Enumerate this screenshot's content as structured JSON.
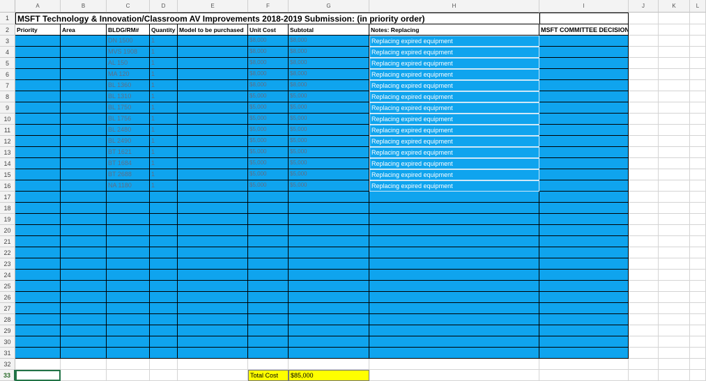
{
  "columns": [
    "A",
    "B",
    "C",
    "D",
    "E",
    "F",
    "G",
    "H",
    "I",
    "J",
    "K",
    "L"
  ],
  "row_numbers": [
    "1",
    "2",
    "3",
    "4",
    "5",
    "6",
    "7",
    "8",
    "9",
    "10",
    "11",
    "12",
    "13",
    "14",
    "15",
    "16",
    "17",
    "18",
    "19",
    "20",
    "21",
    "22",
    "23",
    "24",
    "25",
    "26",
    "27",
    "28",
    "29",
    "30",
    "31",
    "32",
    "33"
  ],
  "active_row": "33",
  "title": "MSFT Technology & Innovation/Classroom AV Improvements 2018-2019 Submission: (in priority order)",
  "headers": {
    "priority": "Priority",
    "area": "Area",
    "bldg": "BLDG/RM#",
    "quantity": "Quantity",
    "model": "Model to be purchased",
    "unit_cost": "Unit Cost",
    "subtotal": "Subtotal",
    "notes": "Notes: Replacing",
    "decision": "MSFT COMMITTEE DECISION:"
  },
  "rows": [
    {
      "bldg": "DN 1500",
      "qty": "1",
      "unit": "$8,000",
      "subtotal": "$8,000",
      "note": "Replacing expired equipment"
    },
    {
      "bldg": "MVS 1908",
      "qty": "1",
      "unit": "$8,000",
      "subtotal": "$8,000",
      "note": "Replacing expired equipment"
    },
    {
      "bldg": "AL 150",
      "qty": "1",
      "unit": "$8,000",
      "subtotal": "$8,000",
      "note": "Replacing expired equipment"
    },
    {
      "bldg": "MA 120",
      "qty": "1",
      "unit": "$8,000",
      "subtotal": "$8,000",
      "note": "Replacing expired equipment"
    },
    {
      "bldg": "BL 1360",
      "qty": "1",
      "unit": "$8,000",
      "subtotal": "$8,000",
      "note": "Replacing expired equipment"
    },
    {
      "bldg": "BL 1310",
      "qty": "1",
      "unit": "$5,000",
      "subtotal": "$5,000",
      "note": "Replacing expired equipment"
    },
    {
      "bldg": "BL 1750",
      "qty": "1",
      "unit": "$5,000",
      "subtotal": "$5,000",
      "note": "Replacing expired equipment"
    },
    {
      "bldg": "BL 1756",
      "qty": "1",
      "unit": "$5,000",
      "subtotal": "$5,000",
      "note": "Replacing expired equipment"
    },
    {
      "bldg": "BL 2480",
      "qty": "1",
      "unit": "$5,000",
      "subtotal": "$5,000",
      "note": "Replacing expired equipment"
    },
    {
      "bldg": "BL 2490",
      "qty": "1",
      "unit": "$5,000",
      "subtotal": "$5,000",
      "note": "Replacing expired equipment"
    },
    {
      "bldg": "BT 1621",
      "qty": "1",
      "unit": "$5,000",
      "subtotal": "$5,000",
      "note": "Replacing expired equipment"
    },
    {
      "bldg": "BT 1684",
      "qty": "1",
      "unit": "$5,000",
      "subtotal": "$5,000",
      "note": "Replacing expired equipment"
    },
    {
      "bldg": "BT 2688",
      "qty": "1",
      "unit": "$5,000",
      "subtotal": "$5,000",
      "note": "Replacing expired equipment"
    },
    {
      "bldg": "NA 1180",
      "qty": "1",
      "unit": "$5,000",
      "subtotal": "$5,000",
      "note": "Replacing expired equipment"
    }
  ],
  "total": {
    "label": "Total Cost",
    "value": "$85,000"
  },
  "colors": {
    "fill_blue": "#0fa4ee",
    "total_yellow": "#ffff00",
    "selection_green": "#217346"
  }
}
